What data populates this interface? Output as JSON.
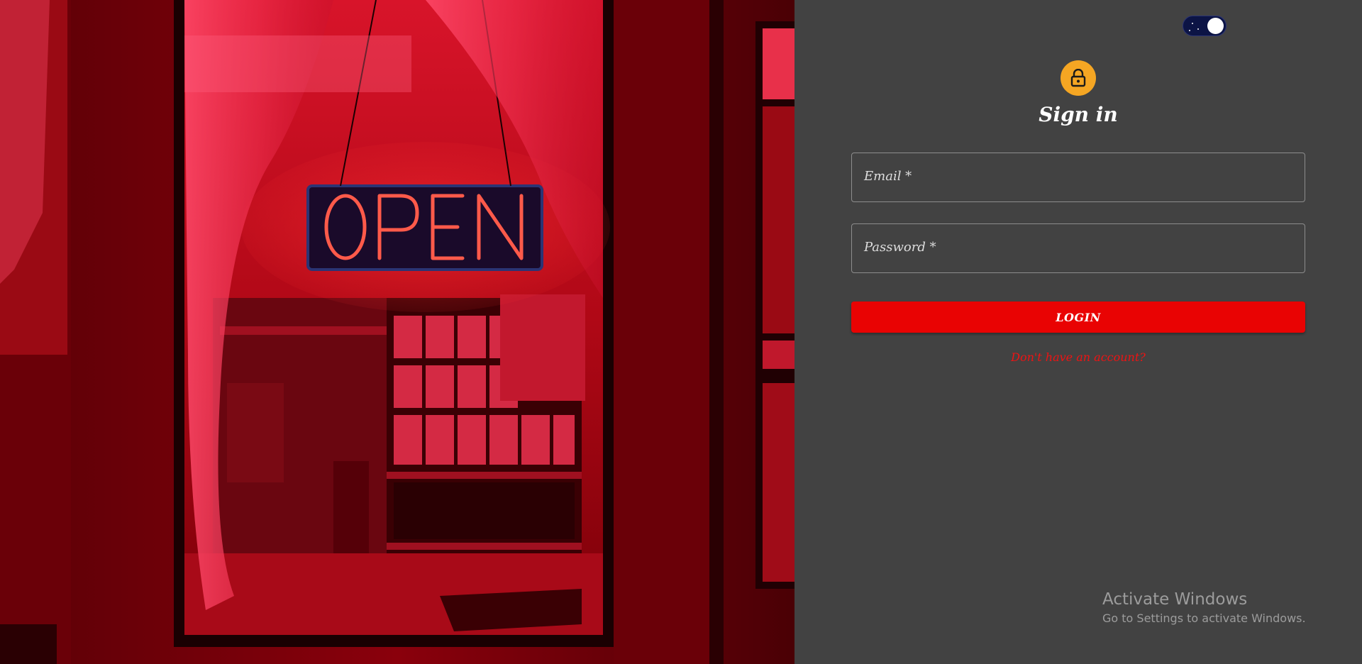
{
  "hero": {
    "sign_text": "OPEN"
  },
  "theme_toggle": {
    "state": "dark"
  },
  "form": {
    "title": "Sign in",
    "email_label": "Email *",
    "email_value": "",
    "password_label": "Password *",
    "password_value": "",
    "login_label": "LOGIN",
    "signup_link": "Don't have an account?"
  },
  "watermark": {
    "title": "Activate Windows",
    "subtitle": "Go to Settings to activate Windows."
  },
  "colors": {
    "panel_bg": "#424242",
    "accent_red": "#e90303",
    "avatar_orange": "#f5a623",
    "toggle_navy": "#0c1445"
  },
  "icons": {
    "avatar": "lock-icon"
  }
}
